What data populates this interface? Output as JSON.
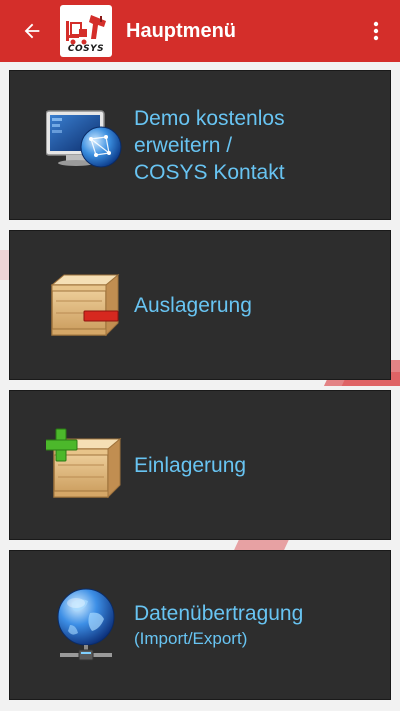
{
  "app_bar": {
    "title": "Hauptmenü",
    "back_icon": "arrow-left-icon",
    "overflow_icon": "more-vert-icon",
    "logo_text": "COSYS",
    "background_color": "#d42e2a"
  },
  "menu": {
    "text_color": "#68c4f2",
    "card_color": "#2d2d2d",
    "items": [
      {
        "lines": [
          "Demo kostenlos",
          "erweitern /",
          "COSYS Kontakt"
        ],
        "icon": "monitor-globe-icon"
      },
      {
        "lines": [
          "Auslagerung"
        ],
        "icon": "crate-minus-icon"
      },
      {
        "lines": [
          "Einlagerung"
        ],
        "icon": "crate-plus-icon"
      },
      {
        "lines": [
          "Datenübertragung"
        ],
        "subtext": "(Import/Export)",
        "icon": "globe-network-icon"
      }
    ]
  }
}
